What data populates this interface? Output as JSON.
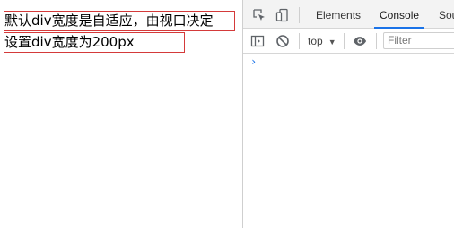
{
  "page": {
    "auto_width_text": "默认div宽度是自适应，由视口决定",
    "fixed_width_text": "设置div宽度为200px"
  },
  "devtools": {
    "tabs": [
      {
        "label": "Elements"
      },
      {
        "label": "Console"
      },
      {
        "label": "Sou"
      }
    ],
    "active_tab": "Console",
    "context_select": "top",
    "filter_placeholder": "Filter",
    "prompt_symbol": "›"
  },
  "colors": {
    "box_border": "#d43a3a",
    "active_tab_underline": "#1a73e8",
    "prompt": "#1a73e8"
  }
}
